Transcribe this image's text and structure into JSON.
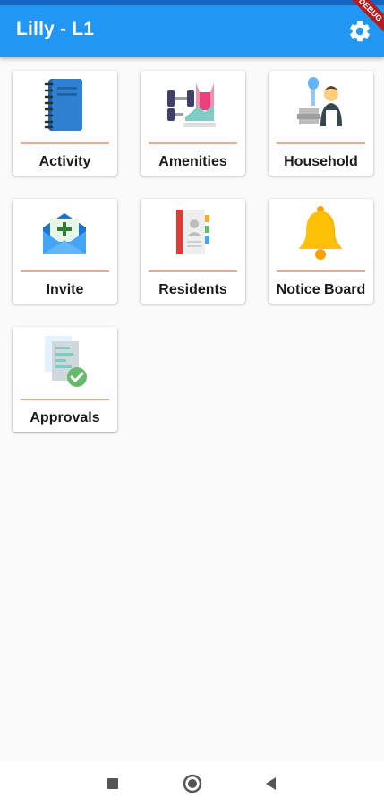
{
  "app_bar": {
    "title": "Lilly - L1",
    "settings_icon": "gear-icon",
    "debug_banner": "DEBUG"
  },
  "colors": {
    "app_bar": "#2196f3",
    "status_bar": "#1565c0",
    "background": "#fafafa",
    "divider": "#e8a98c"
  },
  "grid": {
    "items": [
      {
        "label": "Activity",
        "icon": "notebook-icon"
      },
      {
        "label": "Amenities",
        "icon": "gym-icon"
      },
      {
        "label": "Household",
        "icon": "housekeeper-icon"
      },
      {
        "label": "Invite",
        "icon": "envelope-icon"
      },
      {
        "label": "Residents",
        "icon": "contact-book-icon"
      },
      {
        "label": "Notice Board",
        "icon": "bell-icon"
      },
      {
        "label": "Approvals",
        "icon": "approved-document-icon"
      }
    ]
  },
  "nav_bar": {
    "recents_icon": "square-icon",
    "home_icon": "circle-icon",
    "back_icon": "triangle-back-icon"
  }
}
